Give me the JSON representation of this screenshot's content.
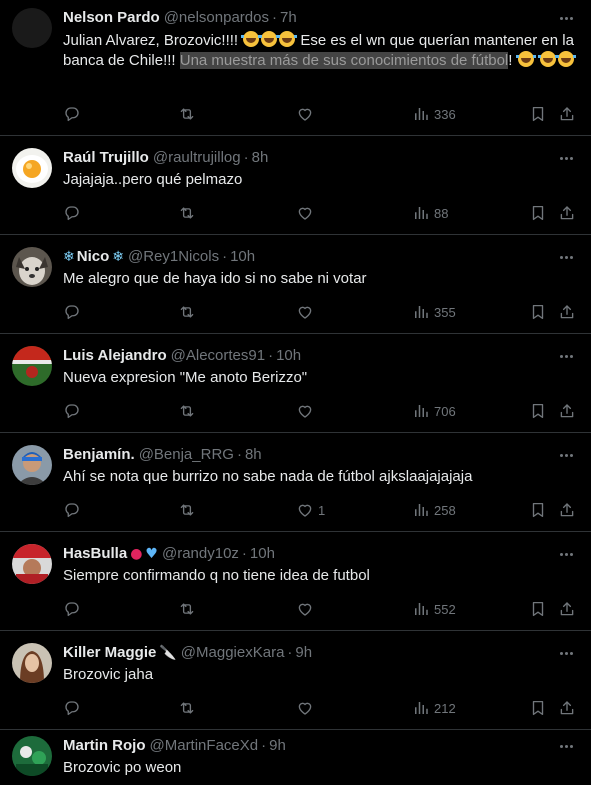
{
  "tweets": [
    {
      "name": "Nelson Pardo",
      "emoji": "",
      "handle": "@nelsonpardos",
      "time": "7h",
      "text_parts": [
        "Julian Alvarez, Brozovic!!!! ",
        " Ese es el wn que querían mantener en la banca de Chile!!! "
      ],
      "highlight": "Una muestra más de sus conocimientos de fútbol",
      "text_end": "! ",
      "likes": "",
      "views": "336"
    },
    {
      "name": "Raúl Trujillo",
      "emoji": "",
      "handle": "@raultrujillog",
      "time": "8h",
      "text": "Jajajaja..pero qué pelmazo",
      "likes": "",
      "views": "88"
    },
    {
      "name": "Nico",
      "emoji_before": "❄",
      "emoji": "❄",
      "handle": "@Rey1Nicols",
      "time": "10h",
      "text": "Me alegro que de haya ido si no sabe ni votar",
      "likes": "",
      "views": "355"
    },
    {
      "name": "Luis Alejandro",
      "emoji": "",
      "handle": "@Alecortes91",
      "time": "10h",
      "text": "Nueva expresion \"Me anoto Berizzo\"",
      "likes": "",
      "views": "706"
    },
    {
      "name": "Benjamín.",
      "emoji": "",
      "handle": "@Benja_RRG",
      "time": "8h",
      "text": "Ahí se nota que burrizo no sabe nada de fútbol ajkslaajajajaja",
      "likes": "1",
      "views": "258"
    },
    {
      "name": "HasBulla",
      "emoji": "●",
      "emoji2": "♥",
      "handle": "@randy10z",
      "time": "10h",
      "text": "Siempre confirmando q no tiene idea de futbol",
      "likes": "",
      "views": "552"
    },
    {
      "name": "Killer Maggie",
      "emoji": "🔪",
      "handle": "@MaggiexKara",
      "time": "9h",
      "text": "Brozovic jaha",
      "likes": "",
      "views": "212"
    },
    {
      "name": "Martin Rojo",
      "emoji": "",
      "handle": "@MartinFaceXd",
      "time": "9h",
      "text": "Brozovic po weon",
      "likes": "",
      "views": ""
    }
  ],
  "icons": {
    "reply": "reply-icon",
    "retweet": "retweet-icon",
    "like": "heart-icon",
    "views": "views-chart-icon",
    "bookmark": "bookmark-icon",
    "share": "share-icon",
    "more": "more-icon"
  },
  "colors": {
    "background": "#000000",
    "text": "#e7e9ea",
    "muted": "#71767b",
    "divider": "#2f3336"
  }
}
